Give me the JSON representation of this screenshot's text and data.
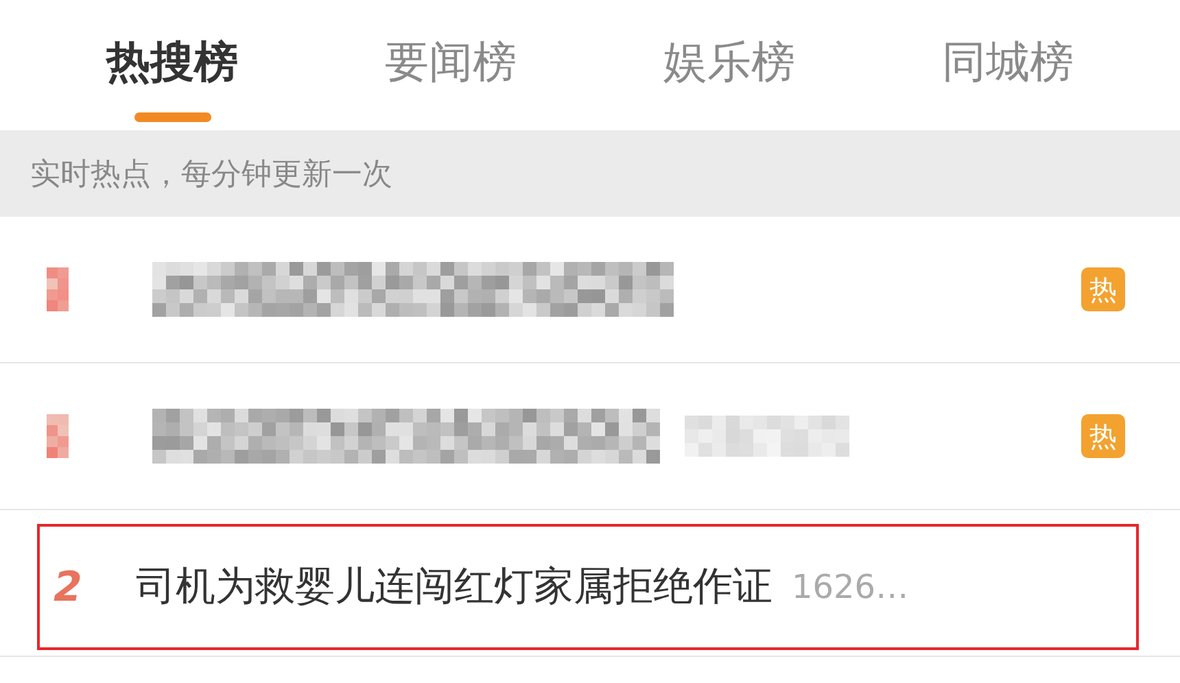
{
  "tabs": [
    {
      "label": "热搜榜",
      "selected": true
    },
    {
      "label": "要闻榜",
      "selected": false
    },
    {
      "label": "娱乐榜",
      "selected": false
    },
    {
      "label": "同城榜",
      "selected": false
    }
  ],
  "notice": "实时热点，每分钟更新一次",
  "items": [
    {
      "kind": "redacted",
      "count_redacted": false,
      "badge": "热",
      "highlighted": false
    },
    {
      "kind": "redacted",
      "count_redacted": true,
      "badge": "热",
      "highlighted": false
    },
    {
      "kind": "text",
      "rank": "2",
      "title": "司机为救婴儿连闯红灯家属拒绝作证",
      "count": "1626…",
      "highlighted": true
    }
  ]
}
